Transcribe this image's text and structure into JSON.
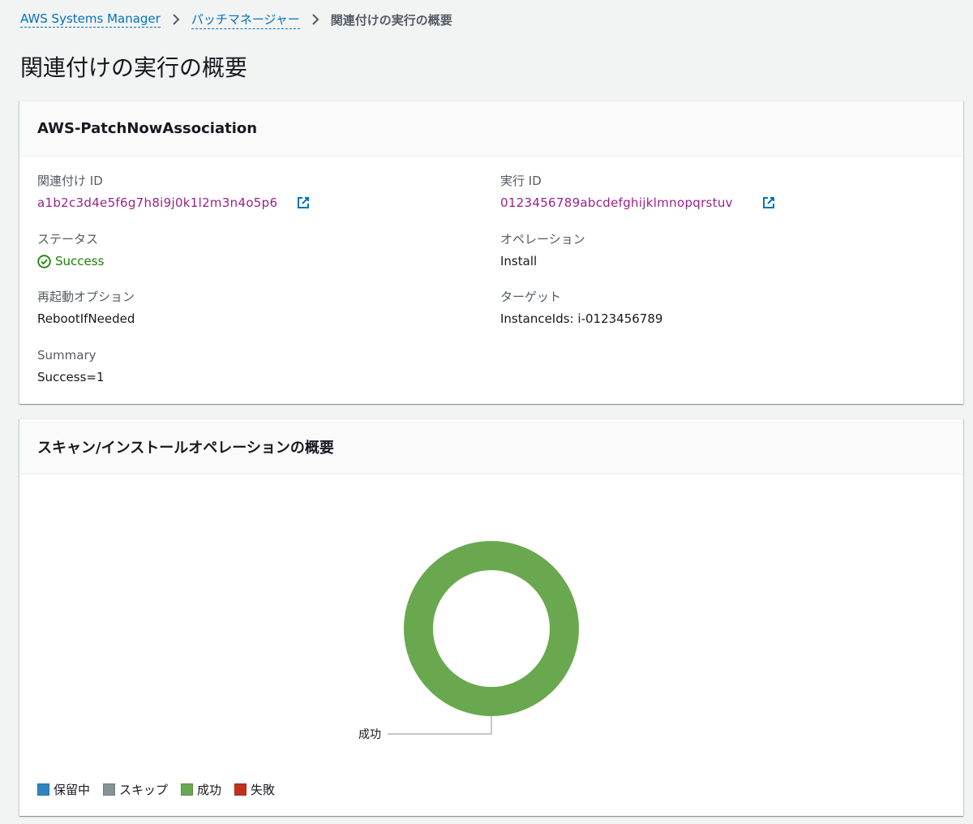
{
  "breadcrumb": {
    "items": [
      "AWS Systems Manager",
      "パッチマネージャー"
    ],
    "current": "関連付けの実行の概要"
  },
  "page": {
    "title": "関連付けの実行の概要"
  },
  "details": {
    "header": "AWS-PatchNowAssociation",
    "association_id": {
      "label": "関連付け ID",
      "value": "a1b2c3d4e5f6g7h8i9j0k1l2m3n4o5p6"
    },
    "execution_id": {
      "label": "実行 ID",
      "value": "0123456789abcdefghijklmnopqrstuv"
    },
    "status": {
      "label": "ステータス",
      "value": "Success"
    },
    "operation": {
      "label": "オペレーション",
      "value": "Install"
    },
    "reboot_option": {
      "label": "再起動オプション",
      "value": "RebootIfNeeded"
    },
    "target": {
      "label": "ターゲット",
      "value_key": "InstanceIds:",
      "value": "i-0123456789"
    },
    "summary": {
      "label": "Summary",
      "value": "Success=1"
    }
  },
  "chart_panel": {
    "header": "スキャン/インストールオペレーションの概要"
  },
  "chart_data": {
    "type": "pie",
    "donut": true,
    "categories": [
      "保留中",
      "スキップ",
      "成功",
      "失敗"
    ],
    "values": [
      0,
      0,
      1,
      0
    ],
    "colors": [
      "#2e86c1",
      "#879196",
      "#6aa84f",
      "#c0311b"
    ],
    "annotations": [
      {
        "category": "成功",
        "label": "成功"
      }
    ],
    "legend_position": "bottom-left"
  },
  "icons": {
    "external_link": "external-link-icon",
    "success": "check-circle-icon",
    "chevron": "chevron-right-icon"
  }
}
